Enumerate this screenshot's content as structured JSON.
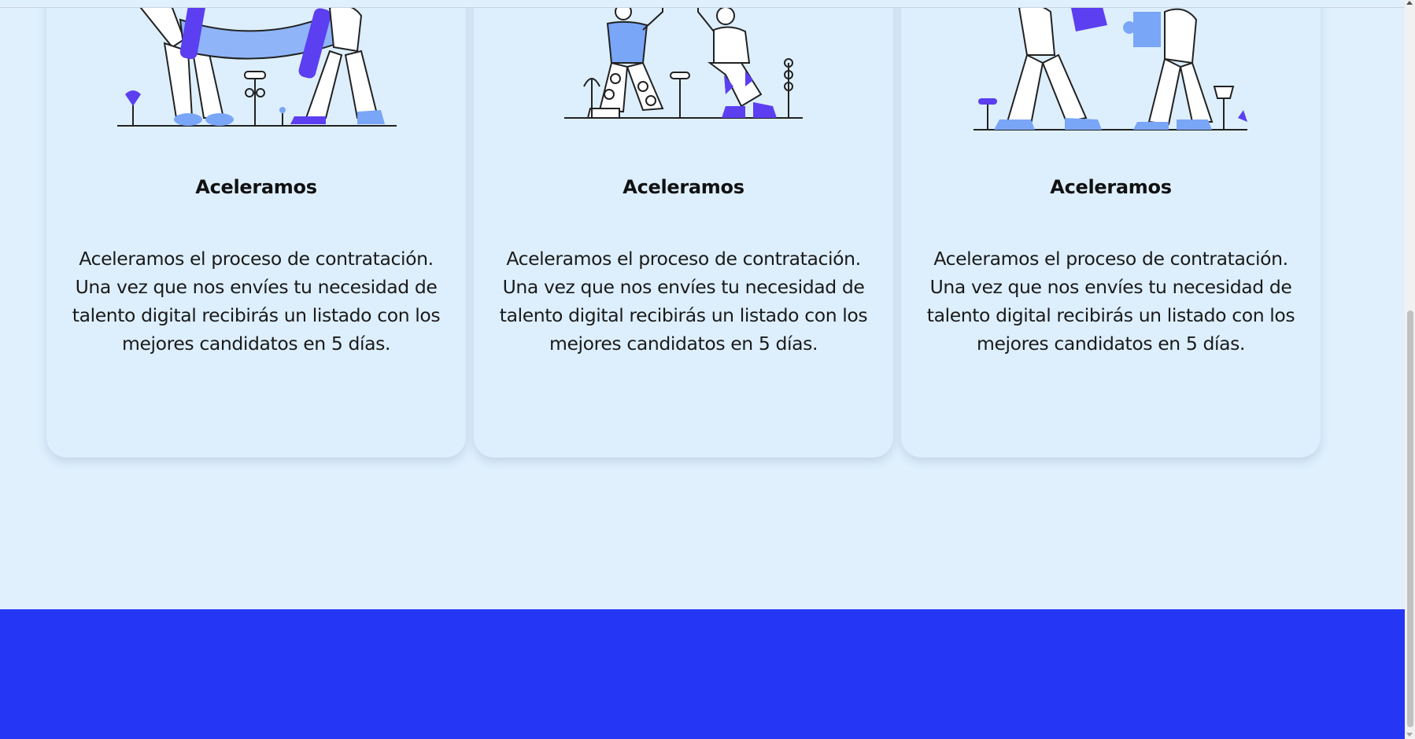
{
  "colors": {
    "page_background": "#e0f0fd",
    "card_background": "#ddeffd",
    "footer_band": "#2636f5",
    "illustration_accent": "#5b3ff0",
    "illustration_light": "#7aa6f7"
  },
  "cards": [
    {
      "illustration": "two-people-carrying-illustration",
      "title": "Aceleramos",
      "text": "Aceleramos el proceso de contratación. Una vez que nos envíes tu necesidad de talento digital recibirás un listado con los mejores candidatos en 5 días."
    },
    {
      "illustration": "high-five-illustration",
      "title": "Aceleramos",
      "text": "Aceleramos el proceso de contratación. Una vez que nos envíes tu necesidad de talento digital recibirás un listado con los mejores candidatos en 5 días."
    },
    {
      "illustration": "puzzle-pieces-illustration",
      "title": "Aceleramos",
      "text": "Aceleramos el proceso de contratación. Una vez que nos envíes tu necesidad de talento digital recibirás un listado con los mejores candidatos en 5 días."
    }
  ]
}
